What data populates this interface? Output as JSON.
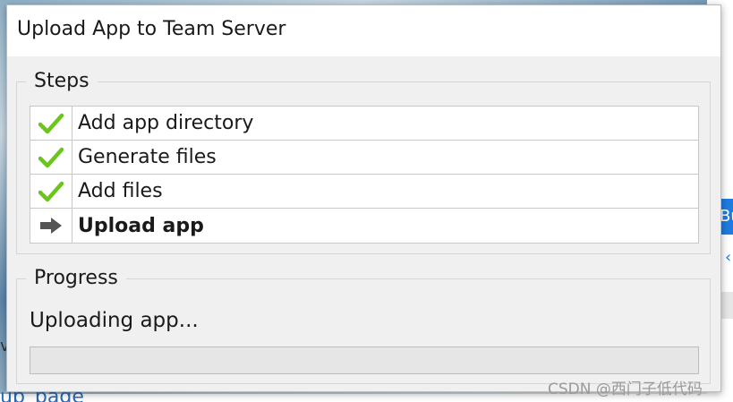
{
  "dialog": {
    "title": "Upload App to Team Server"
  },
  "steps": {
    "legend": "Steps",
    "items": [
      {
        "icon": "check-icon",
        "label": "Add app directory",
        "status": "done"
      },
      {
        "icon": "check-icon",
        "label": "Generate files",
        "status": "done"
      },
      {
        "icon": "check-icon",
        "label": "Add files",
        "status": "done"
      },
      {
        "icon": "arrow-right-icon",
        "label": "Upload app",
        "status": "current"
      }
    ]
  },
  "progress": {
    "legend": "Progress",
    "status_text": "Uploading app...",
    "fraction": 0
  },
  "background": {
    "button_text": "Bu",
    "link_text": "up_page"
  },
  "watermark": "CSDN @西门子低代码",
  "colors": {
    "check": "#6cc51a",
    "arrow": "#555555",
    "progress_fill": "#06b025"
  }
}
